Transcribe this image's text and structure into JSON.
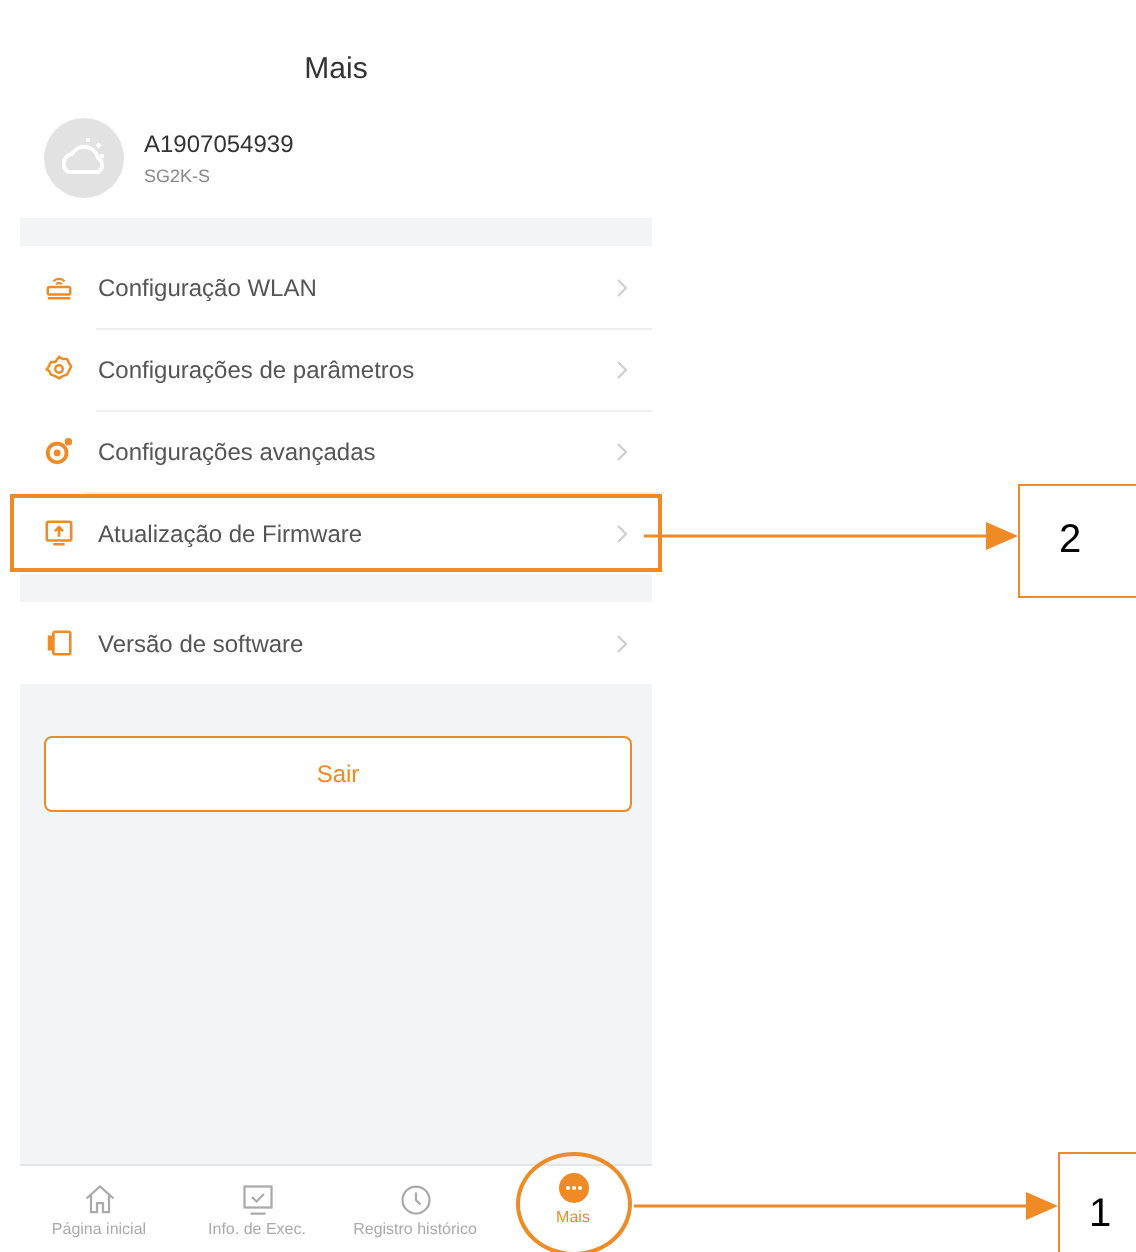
{
  "header": {
    "title": "Mais"
  },
  "device": {
    "name": "A1907054939",
    "model": "SG2K-S"
  },
  "menu_groups": [
    {
      "items": [
        {
          "label": "Configuração WLAN",
          "highlighted": false
        },
        {
          "label": "Configurações de parâmetros",
          "highlighted": false
        },
        {
          "label": "Configurações avançadas",
          "highlighted": false
        },
        {
          "label": "Atualização de Firmware",
          "highlighted": true
        }
      ]
    },
    {
      "items": [
        {
          "label": "Versão de software",
          "highlighted": false
        }
      ]
    }
  ],
  "logout_button": "Sair",
  "nav": [
    {
      "label": "Página inicial",
      "selected": false,
      "highlighted": false
    },
    {
      "label": "Info. de Exec.",
      "selected": false,
      "highlighted": false
    },
    {
      "label": "Registro histórico",
      "selected": false,
      "highlighted": false
    },
    {
      "label": "Mais",
      "selected": true,
      "highlighted": true
    }
  ],
  "callouts": [
    {
      "label": "2",
      "kind": "menu"
    },
    {
      "label": "1",
      "kind": "nav"
    }
  ]
}
